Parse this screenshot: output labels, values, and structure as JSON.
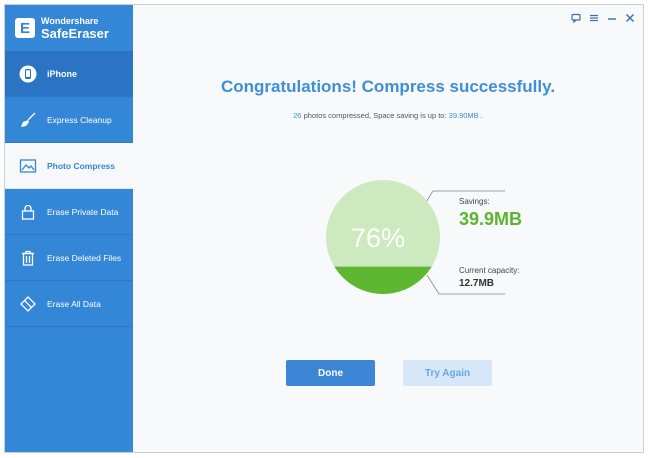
{
  "app": {
    "brand_top": "Wondershare",
    "brand_name": "SafeEraser",
    "logo_letter": "E"
  },
  "sidebar": {
    "items": [
      {
        "label": "iPhone",
        "icon": "iphone-icon"
      },
      {
        "label": "Express Cleanup",
        "icon": "broom-icon"
      },
      {
        "label": "Photo Compress",
        "icon": "photo-icon"
      },
      {
        "label": "Erase Private Data",
        "icon": "lock-icon"
      },
      {
        "label": "Erase Deleted Files",
        "icon": "trash-icon"
      },
      {
        "label": "Erase All Data",
        "icon": "eraser-icon"
      }
    ],
    "active": "Photo Compress"
  },
  "window_controls": [
    "feedback-icon",
    "menu-icon",
    "minimize-icon",
    "close-icon"
  ],
  "main": {
    "headline": "Congratulations! Compress successfully.",
    "sub_count": "26",
    "sub_mid": " photos compressed, Space saving is up to: ",
    "sub_size": "39.90MB",
    "sub_end": " .",
    "percent_text": "76%",
    "savings_label": "Savings:",
    "savings_value": "39.9MB",
    "capacity_label": "Current capacity:",
    "capacity_value": "12.7MB",
    "done_label": "Done",
    "try_again_label": "Try Again"
  },
  "gauge": {
    "saved_fraction": 0.76,
    "colors": {
      "saved": "#cde9c0",
      "remaining": "#5db730",
      "text": "#ffffff"
    }
  },
  "colors": {
    "accent": "#3486d6",
    "success": "#5cb531"
  }
}
